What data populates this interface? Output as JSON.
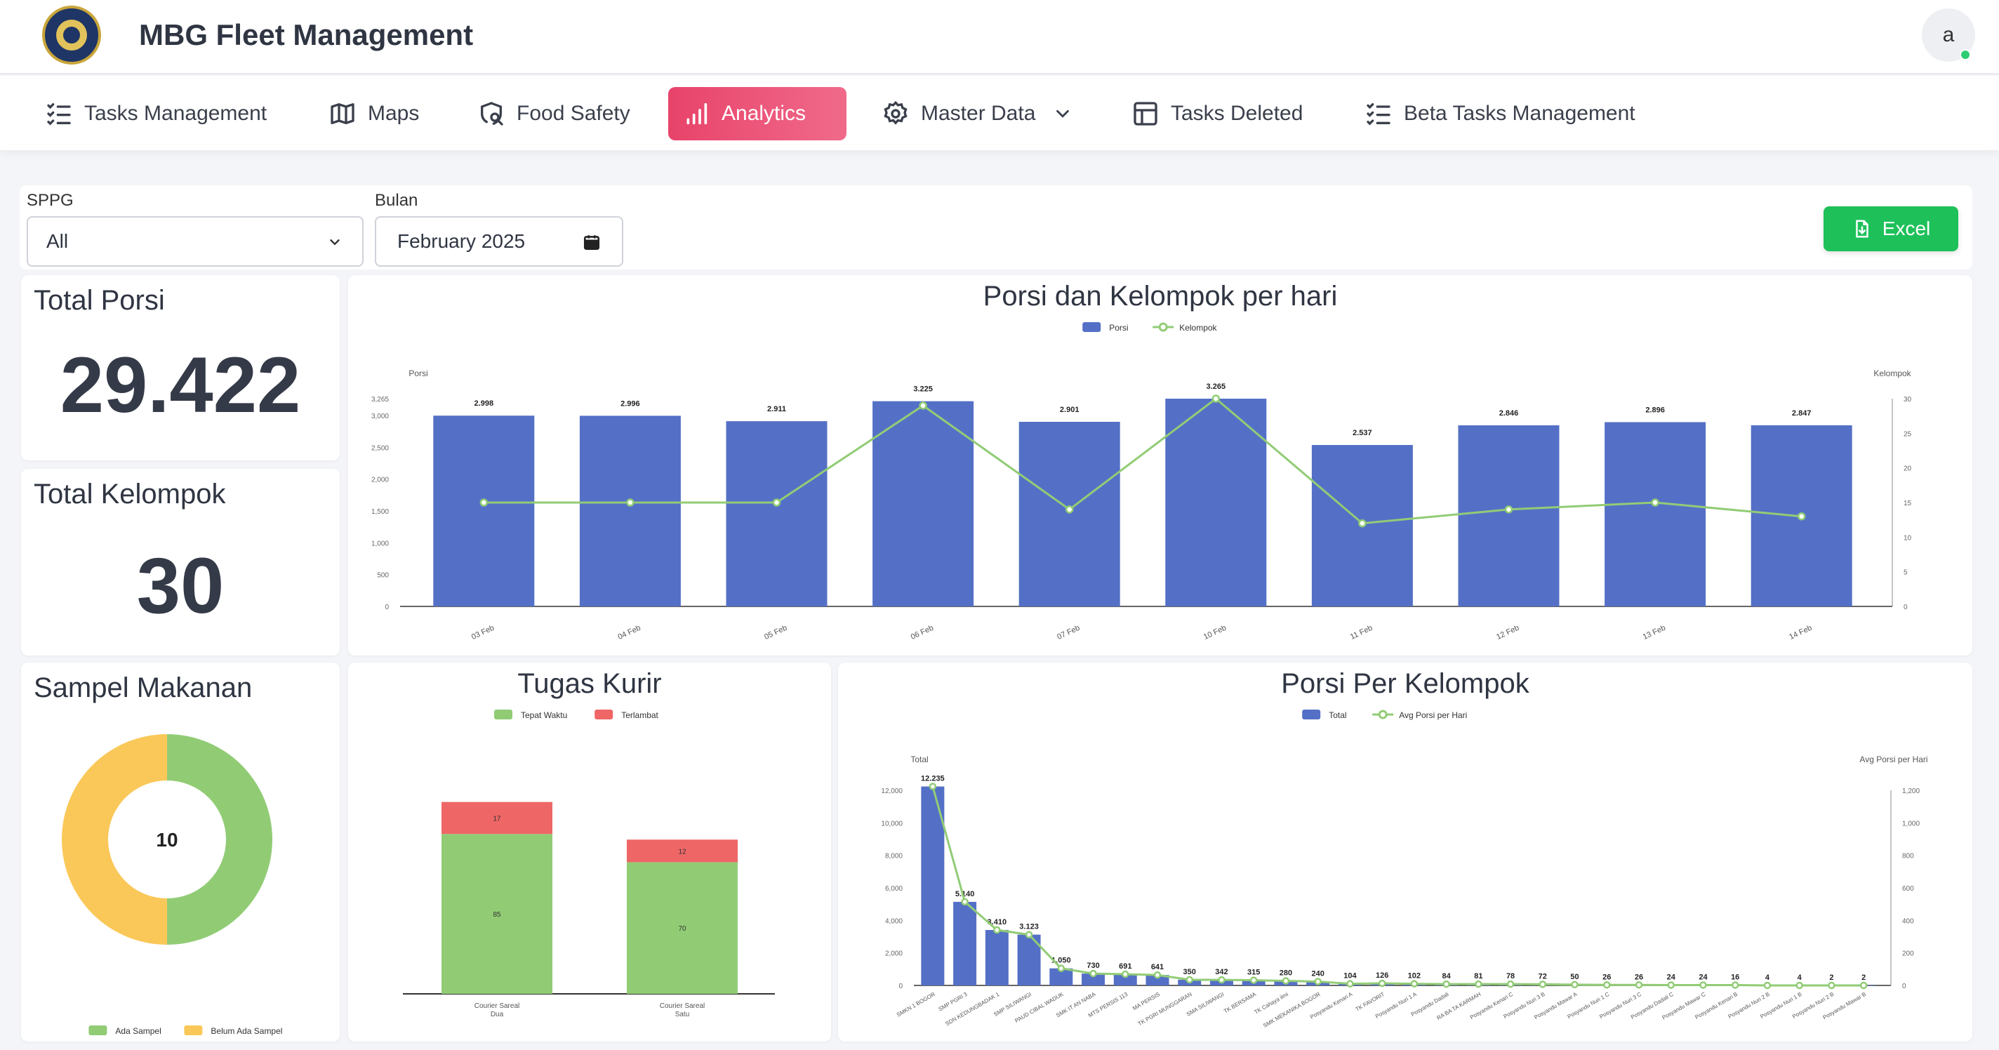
{
  "header": {
    "title": "MBG Fleet Management",
    "avatar_letter": "a"
  },
  "nav": {
    "items": [
      {
        "label": "Tasks Management",
        "icon": "task-list-icon",
        "active": false
      },
      {
        "label": "Maps",
        "icon": "map-icon",
        "active": false
      },
      {
        "label": "Food Safety",
        "icon": "shield-search-icon",
        "active": false
      },
      {
        "label": "Analytics",
        "icon": "bar-chart-icon",
        "active": true
      },
      {
        "label": "Master Data",
        "icon": "gear-icon",
        "active": false
      },
      {
        "label": "Tasks Deleted",
        "icon": "table-icon",
        "active": false
      },
      {
        "label": "Beta Tasks Management",
        "icon": "task-list-icon",
        "active": false
      }
    ]
  },
  "filters": {
    "sppg_label": "SPPG",
    "sppg_value": "All",
    "bulan_label": "Bulan",
    "bulan_value": "February 2025",
    "excel_label": "Excel"
  },
  "stats": {
    "total_porsi_label": "Total Porsi",
    "total_porsi_value": "29.422",
    "total_kelompok_label": "Total Kelompok",
    "total_kelompok_value": "30"
  },
  "colors": {
    "blue": "#5470c6",
    "green": "#91cc75",
    "red": "#ee6666",
    "yellow": "#fac858",
    "accent": "#e8436a",
    "excel": "#1ec05a"
  },
  "chart_data": [
    {
      "type": "bar",
      "title": "Porsi dan Kelompok per hari",
      "categories": [
        "03 Feb",
        "04 Feb",
        "05 Feb",
        "06 Feb",
        "07 Feb",
        "10 Feb",
        "11 Feb",
        "12 Feb",
        "13 Feb",
        "14 Feb"
      ],
      "series": [
        {
          "name": "Porsi",
          "type": "bar",
          "axis": "left",
          "values": [
            2998,
            2996,
            2911,
            3225,
            2901,
            3265,
            2537,
            2846,
            2896,
            2847
          ],
          "labels": [
            "2.998",
            "2.996",
            "2.911",
            "3.225",
            "2.901",
            "3.265",
            "2.537",
            "2.846",
            "2.896",
            "2.847"
          ]
        },
        {
          "name": "Kelompok",
          "type": "line",
          "axis": "right",
          "values": [
            15,
            15,
            15,
            29,
            14,
            30,
            12,
            14,
            15,
            13
          ]
        }
      ],
      "ylabel": "Porsi",
      "y2label": "Kelompok",
      "ylim": [
        0,
        3265
      ],
      "yticks": [
        "0",
        "500",
        "1,000",
        "1,500",
        "2,000",
        "2,500",
        "3,000",
        "3,265"
      ],
      "y2lim": [
        0,
        30
      ],
      "y2ticks": [
        "0",
        "5",
        "10",
        "15",
        "20",
        "25",
        "30"
      ]
    },
    {
      "type": "pie",
      "title": "Sampel Makanan",
      "center_label": "10",
      "series": [
        {
          "name": "Ada Sampel",
          "value": 5
        },
        {
          "name": "Belum Ada Sampel",
          "value": 5
        }
      ]
    },
    {
      "type": "bar",
      "title": "Tugas Kurir",
      "stacked": true,
      "categories": [
        "Courier Sareal Dua",
        "Courier Sareal Satu"
      ],
      "series": [
        {
          "name": "Tepat Waktu",
          "values": [
            85,
            70
          ]
        },
        {
          "name": "Terlambat",
          "values": [
            17,
            12
          ]
        }
      ]
    },
    {
      "type": "bar",
      "title": "Porsi Per Kelompok",
      "categories": [
        "SMKN 1 BOGOR",
        "SMP PGRI 3",
        "SDN KEDUNGBADAK 1",
        "SMP SILIWANGI",
        "PAUD CIBAL WADUK",
        "SMK IT AN NABA",
        "MTS PERSIS 113",
        "MA PERSIS",
        "TK PGRI MUNGGARAN",
        "SMA SILIWANGI",
        "TK BERSAMA",
        "TK Cahaya ilmi",
        "SMK MEKANIKA BOGOR",
        "Posyandu Kenari A",
        "TK FAVORIT",
        "Posyandu Nuri 1 A",
        "Posyandu Dadali",
        "RA BA TA KARMAH",
        "Posyandu Kenari C",
        "Posyandu Nuri 3 B",
        "Posyandu Mawar A",
        "Posyandu Nuri 1 C",
        "Posyandu Nuri 3 C",
        "Posyandu Dadali C",
        "Posyandu Mawar C",
        "Posyandu Kenari B",
        "Posyandu Nuri 2 B",
        "Posyandu Nuri 1 B",
        "Posyandu Nuri 2 B",
        "Posyandu Mawar B"
      ],
      "series": [
        {
          "name": "Total",
          "type": "bar",
          "axis": "left",
          "values": [
            12235,
            5140,
            3410,
            3123,
            1050,
            730,
            691,
            641,
            350,
            342,
            315,
            280,
            240,
            104,
            126,
            102,
            84,
            81,
            78,
            72,
            50,
            26,
            26,
            24,
            24,
            16,
            4,
            4,
            2,
            2
          ],
          "labels": [
            "12.235",
            "5.140",
            "3.410",
            "3.123",
            "1.050",
            "730",
            "691",
            "641",
            "350",
            "342",
            "315",
            "280",
            "240",
            "104",
            "126",
            "102",
            "84",
            "81",
            "78",
            "72",
            "50",
            "26",
            "26",
            "24",
            "24",
            "16",
            "4",
            "4",
            "2",
            "2"
          ]
        },
        {
          "name": "Avg Porsi per Hari",
          "type": "line",
          "axis": "right",
          "values": [
            1224,
            514,
            341,
            312,
            105,
            73,
            69,
            64,
            35,
            34,
            32,
            28,
            24,
            10,
            13,
            10,
            8,
            8,
            8,
            7,
            5,
            3,
            3,
            2,
            2,
            2,
            0,
            0,
            0,
            0
          ]
        }
      ],
      "ylabel": "Total",
      "y2label": "Avg Porsi per Hari",
      "ylim": [
        0,
        12000
      ],
      "yticks": [
        "0",
        "2,000",
        "4,000",
        "6,000",
        "8,000",
        "10,000",
        "12,000"
      ],
      "y2lim": [
        0,
        1200
      ],
      "y2ticks": [
        "0",
        "200",
        "400",
        "600",
        "800",
        "1,000",
        "1,200"
      ]
    }
  ]
}
